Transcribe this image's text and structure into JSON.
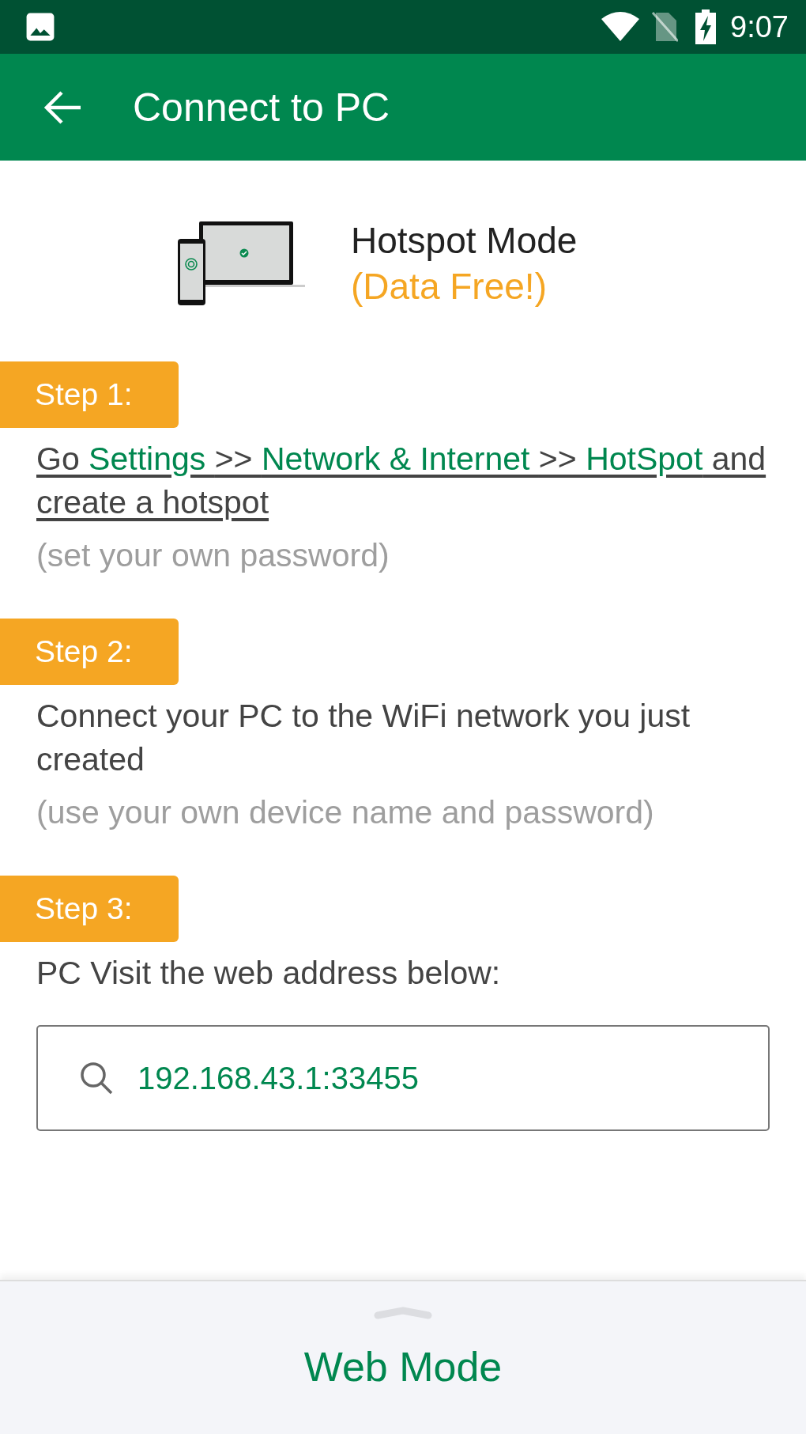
{
  "status_bar": {
    "time": "9:07"
  },
  "app_bar": {
    "title": "Connect to PC"
  },
  "mode": {
    "title": "Hotspot Mode",
    "subtitle": "(Data Free!)"
  },
  "steps": [
    {
      "label": "Step 1:",
      "underlined": true,
      "segments": [
        {
          "kind": "text",
          "text": "Go "
        },
        {
          "kind": "link",
          "text": "Settings "
        },
        {
          "kind": "text",
          "text": ">> "
        },
        {
          "kind": "link",
          "text": "Network & Internet "
        },
        {
          "kind": "text",
          "text": ">> "
        },
        {
          "kind": "link",
          "text": "HotSpot"
        },
        {
          "kind": "text",
          "text": " and create a hotspot"
        }
      ],
      "hint": "(set your own password)"
    },
    {
      "label": "Step 2:",
      "underlined": false,
      "segments": [
        {
          "kind": "text",
          "text": "Connect your PC to the WiFi network you just created"
        }
      ],
      "hint": "(use your own device name and password)"
    },
    {
      "label": "Step 3:",
      "underlined": false,
      "segments": [
        {
          "kind": "text",
          "text": "PC Visit the web address below:"
        }
      ]
    }
  ],
  "address": {
    "value": "192.168.43.1:33455"
  },
  "bottom_sheet": {
    "title": "Web Mode"
  }
}
